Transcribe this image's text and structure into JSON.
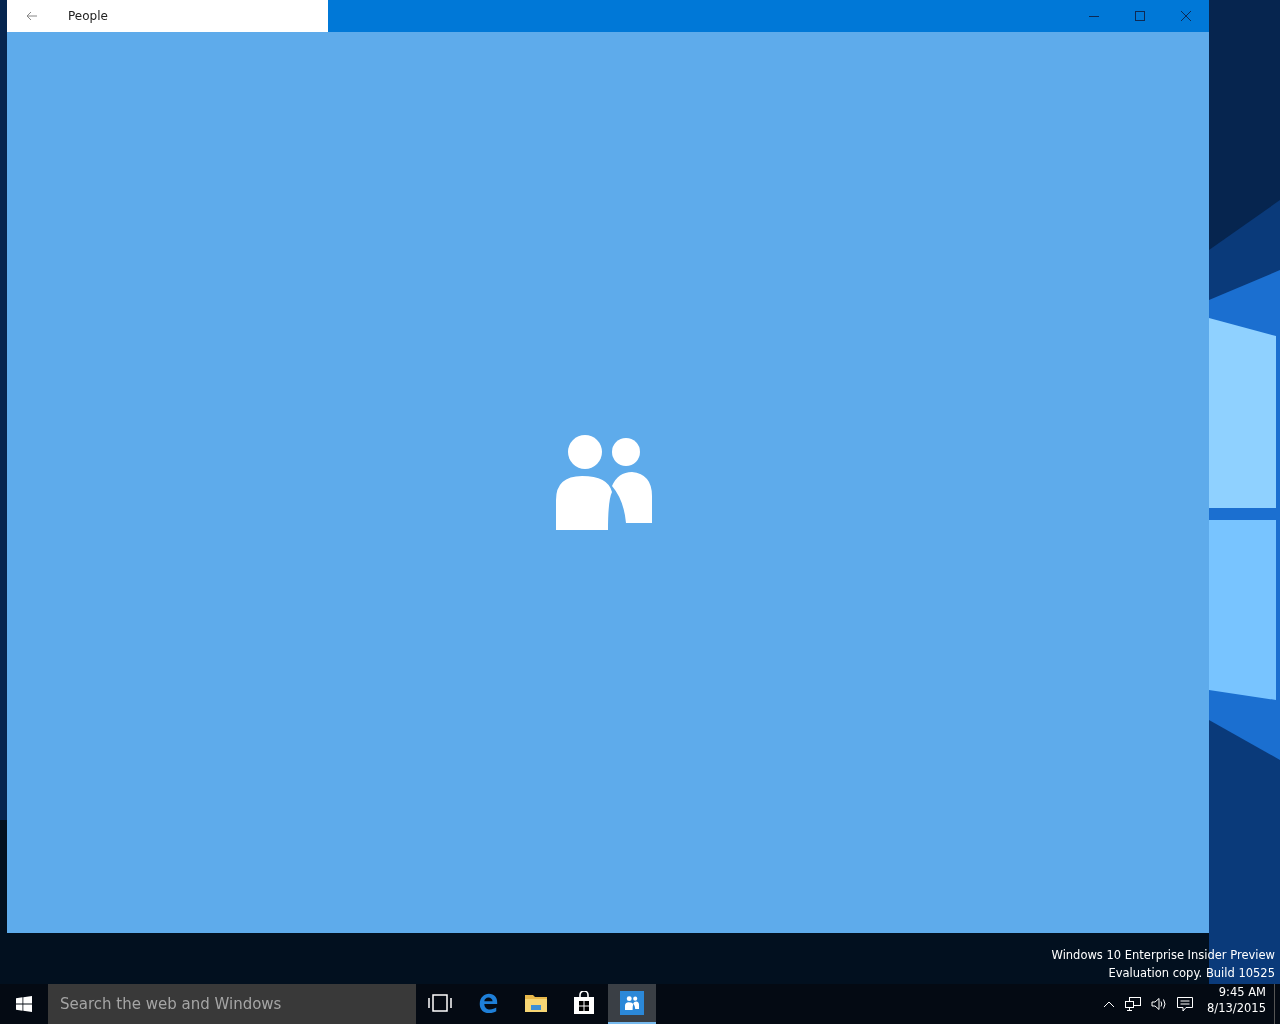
{
  "window": {
    "title": "People",
    "active": true
  },
  "taskbar": {
    "search": {
      "placeholder": "Search the web and Windows"
    },
    "apps": [
      {
        "kind": "task-view",
        "selected": false
      },
      {
        "kind": "edge",
        "selected": false
      },
      {
        "kind": "explorer",
        "selected": false
      },
      {
        "kind": "store",
        "selected": false
      },
      {
        "kind": "people",
        "selected": true
      }
    ],
    "clock": {
      "time": "9:45 AM",
      "date": "8/13/2015"
    }
  },
  "desktop_notice": [
    "Windows 10 Enterprise Insider Preview",
    "Evaluation copy. Build 10525"
  ]
}
